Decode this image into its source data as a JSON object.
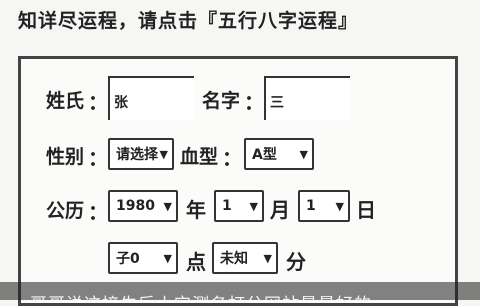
{
  "headline": "知详尽运程，请点击『五行八字运程』",
  "form": {
    "surname_label": "姓氏",
    "surname_value": "张",
    "givenname_label": "名字",
    "givenname_value": "三",
    "gender_label": "性别",
    "gender_value": "请选择",
    "blood_label": "血型",
    "blood_value": "A型",
    "calendar_label": "公历",
    "colon": "：",
    "year_value": "1980",
    "year_unit": "年",
    "month_value": "1",
    "month_unit": "月",
    "day_value": "1",
    "day_unit": "日",
    "hour_value": "子0",
    "hour_unit": "点",
    "minute_value": "未知",
    "minute_unit": "分",
    "dropdown_glyph": "▼"
  },
  "overlay": {
    "caption": "哥哥说这接生后小宝测名打分网站最最好的"
  }
}
